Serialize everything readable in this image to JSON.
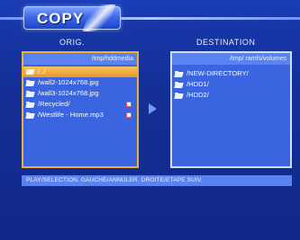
{
  "header": {
    "title": "COPY"
  },
  "origin": {
    "heading": "ORIG.",
    "path": "/tmp/hddmedia",
    "items": [
      {
        "label": "/../",
        "icon": "up-folder-icon",
        "selected": true,
        "marked": false
      },
      {
        "label": "/wall2-1024x768.jpg",
        "icon": "folder-icon",
        "selected": false,
        "marked": false
      },
      {
        "label": "/wall3-1024x768.jpg",
        "icon": "folder-icon",
        "selected": false,
        "marked": false
      },
      {
        "label": "/Recycled/",
        "icon": "folder-icon",
        "selected": false,
        "marked": true
      },
      {
        "label": "/Westlife - Home.mp3",
        "icon": "folder-icon",
        "selected": false,
        "marked": true
      }
    ]
  },
  "destination": {
    "heading": "DESTINATION",
    "path": "/tmp/ ramfs/volumes",
    "items": [
      {
        "label": "/NEW-DIRECTORY/",
        "icon": "folder-icon"
      },
      {
        "label": "/HDD1/",
        "icon": "folder-icon"
      },
      {
        "label": "/HDD2/",
        "icon": "folder-icon"
      }
    ]
  },
  "status_bar": {
    "text": "PLAY/SELECTION. GAUCHE/ANNULER. DROITE/ETAPE SUIV."
  },
  "colors": {
    "background": "#142f96",
    "panel": "#3a64e0",
    "selection": "#f0b030",
    "accent": "#6f9cff"
  }
}
